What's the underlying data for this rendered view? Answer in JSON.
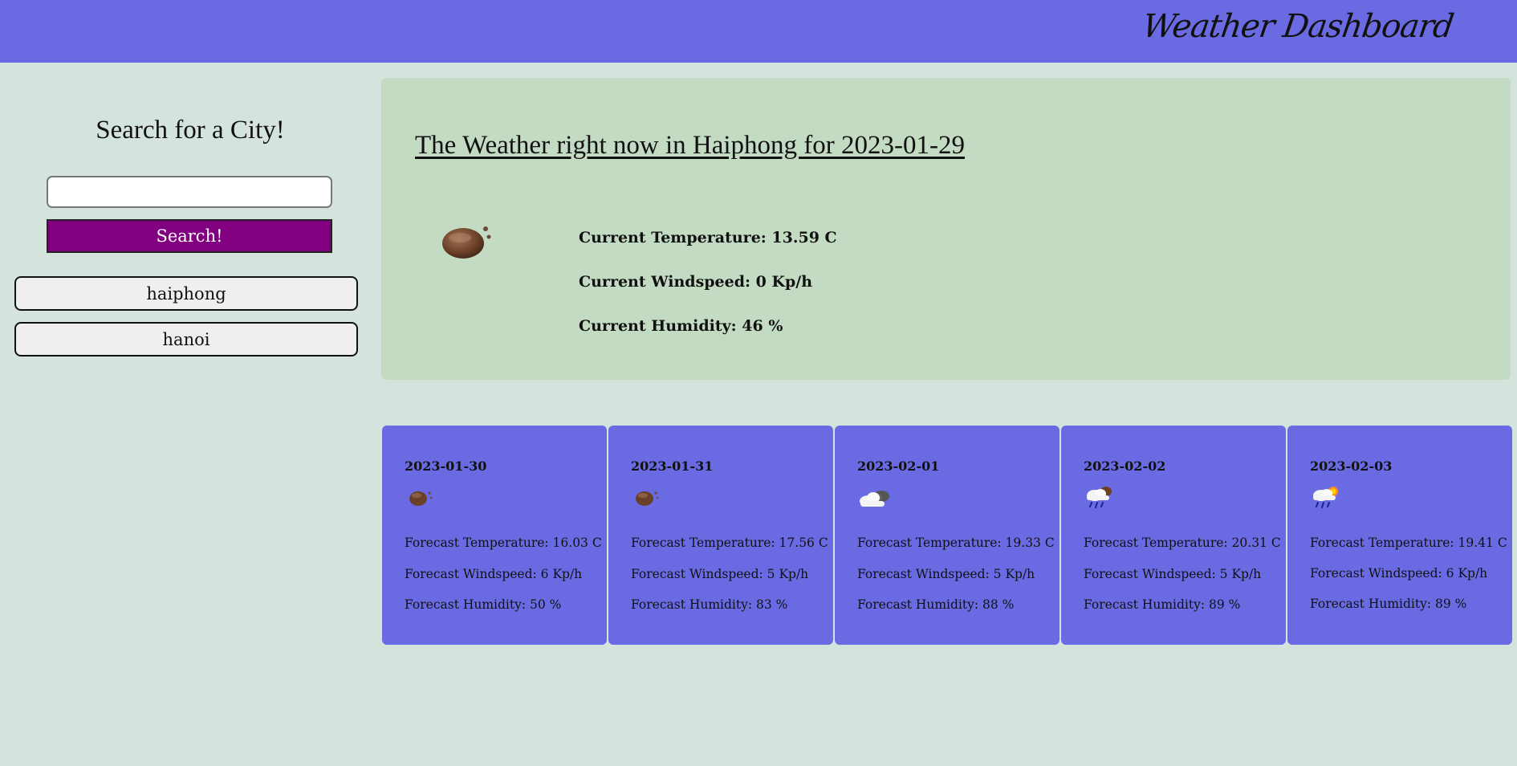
{
  "header": {
    "brand": "Weather Dashboard"
  },
  "sidebar": {
    "title": "Search for a City!",
    "search_input_value": "",
    "search_button_label": "Search!",
    "history": [
      {
        "label": "haiphong"
      },
      {
        "label": "hanoi"
      }
    ]
  },
  "current": {
    "title": "The Weather right now in Haiphong for 2023-01-29",
    "icon": "clear-night-icon",
    "temperature": "Current Temperature: 13.59 C",
    "windspeed": "Current Windspeed: 0 Kp/h",
    "humidity": "Current Humidity: 46 %"
  },
  "forecast": [
    {
      "date": "2023-01-30",
      "icon": "clear-night-icon",
      "temperature": "Forecast Temperature: 16.03 C",
      "windspeed": "Forecast Windspeed: 6 Kp/h",
      "humidity": "Forecast Humidity: 50 %"
    },
    {
      "date": "2023-01-31",
      "icon": "clear-night-icon",
      "temperature": "Forecast Temperature: 17.56 C",
      "windspeed": "Forecast Windspeed: 5 Kp/h",
      "humidity": "Forecast Humidity: 83 %"
    },
    {
      "date": "2023-02-01",
      "icon": "cloudy-icon",
      "temperature": "Forecast Temperature: 19.33 C",
      "windspeed": "Forecast Windspeed: 5 Kp/h",
      "humidity": "Forecast Humidity: 88 %"
    },
    {
      "date": "2023-02-02",
      "icon": "rain-night-icon",
      "temperature": "Forecast Temperature: 20.31 C",
      "windspeed": "Forecast Windspeed: 5 Kp/h",
      "humidity": "Forecast Humidity: 89 %"
    },
    {
      "date": "2023-02-03",
      "icon": "rain-day-icon",
      "temperature": "Forecast Temperature: 19.41 C",
      "windspeed": "Forecast Windspeed: 6 Kp/h",
      "humidity": "Forecast Humidity: 89 %"
    }
  ],
  "colors": {
    "header": "#6a6be3",
    "background": "#d4e4dc",
    "current_panel": "#c3dbc3",
    "search_button": "#800080",
    "card": "#6a6be3"
  }
}
